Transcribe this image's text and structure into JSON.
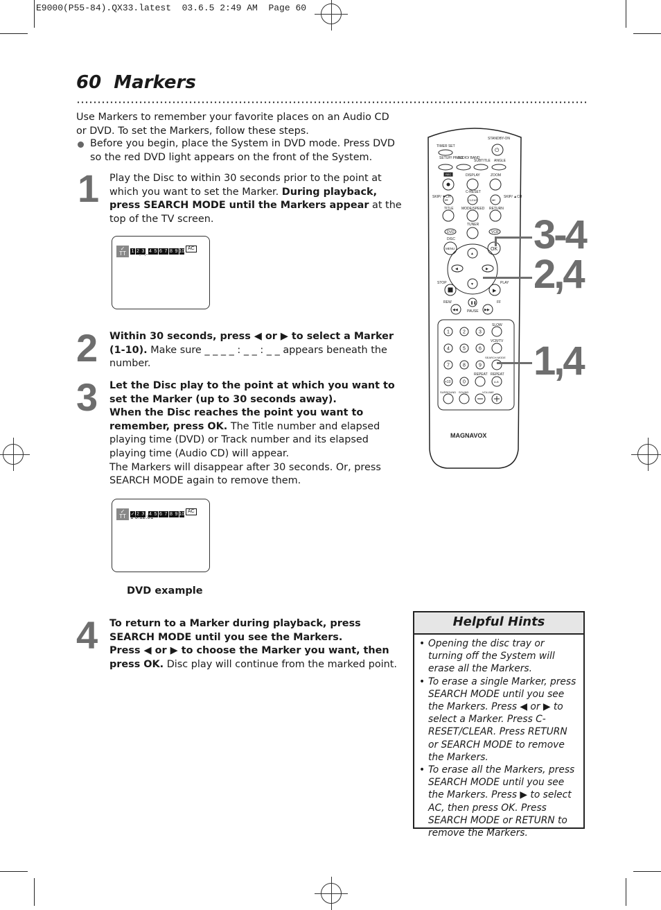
{
  "print_slug": "E9000(P55-84).QX33.latest  03.6.5 2:49 AM  Page 60",
  "header": {
    "page_number": "60",
    "title": "Markers"
  },
  "intro": {
    "text": "Use Markers to remember your favorite places on an Audio CD or DVD. To set the Markers, follow these steps.",
    "bullet": "Before you begin, place the System in DVD mode. Press DVD so the red DVD light appears on the front of the System."
  },
  "steps": [
    {
      "number": "1",
      "plain1": "Play the Disc to within 30 seconds prior to the point at which you want to set the Marker. ",
      "bold1": "During playback, press SEARCH MODE until the Markers appear",
      "plain2": " at the top of the TV screen."
    },
    {
      "number": "2",
      "bold1": "Within 30 seconds, press ◀ or ▶ to select a Marker (1-10).",
      "plain1": " Make sure _ _  _ _ : _ _ : _ _  appears beneath the number."
    },
    {
      "number": "3",
      "bold1": "Let the Disc play to the point at which you want to set the Marker (up to 30 seconds away).",
      "bold2": "When the Disc reaches the point you want to remember, press OK.",
      "plain1": " The Title number and elapsed playing time (DVD) or Track number and its elapsed playing time (Audio CD) will appear.",
      "plain2": "The Markers will disappear after 30 seconds. Or, press SEARCH MODE again to remove them."
    },
    {
      "number": "4",
      "bold1": "To return to a Marker during playback, press SEARCH MODE until you  see the Markers.",
      "bold2": "Press ◀ or ▶ to choose the Marker you want, then press OK.",
      "plain1": " Disc play will continue from the marked point."
    }
  ],
  "screens": [
    {
      "marker_icon": "✓",
      "title_icon": "TT",
      "markers": [
        "1",
        "2",
        "3",
        "4",
        "5",
        "6",
        "7",
        "8",
        "9",
        "10"
      ],
      "clear_all": "AC",
      "readout": "-- --:--:--"
    },
    {
      "marker_icon": "✓",
      "title_icon": "TT",
      "markers": [
        "✓",
        "2",
        "3",
        "4",
        "5",
        "6",
        "7",
        "8",
        "9",
        "10"
      ],
      "clear_all": "AC",
      "readout": "1  0:12:01"
    }
  ],
  "screen_caption": "DVD example",
  "hints": {
    "title": "Helpful Hints",
    "items": [
      "Opening the disc tray or turning off the System will erase all the Markers.",
      "To erase a single Marker, press SEARCH MODE until you see the Markers. Press ◀ or ▶ to select a Marker. Press C-RESET/CLEAR. Press RETURN or SEARCH MODE to remove the Markers.",
      "To erase all the Markers, press SEARCH MODE until you see the Markers. Press ▶ to select AC, then press OK. Press SEARCH MODE or RETURN to remove the Markers."
    ]
  },
  "callouts": [
    "3-4",
    "2,4",
    "1,4"
  ],
  "remote": {
    "brand": "MAGNAVOX",
    "labels": {
      "standby": "STANDBY-ON",
      "timer_set": "TIMER SET",
      "setup": "SETUP/ PROG.",
      "audio": "AUDIO/ BAND",
      "subtitle": "SUBTITLE",
      "angle": "ANGLE",
      "rec": "REC",
      "display": "DISPLAY",
      "zoom": "ZOOM",
      "c_reset": "C-RESET",
      "clear": "CLEAR",
      "skip_down": "SKIP/ ▼CH",
      "skip_up": "SKIP/ ▲CH",
      "title": "TITLE",
      "mode_speed": "MODE/SPEED",
      "return": "RETURN",
      "tuner": "TUNER",
      "dvd": "DVD",
      "vcr": "VCR",
      "disc": "DISC",
      "menu": "MENU",
      "ok": "OK",
      "stop": "STOP",
      "play": "PLAY",
      "rew": "REW",
      "ff": "FF",
      "pause": "PAUSE",
      "slow": "SLOW",
      "vcr_tv": "VCR/TV",
      "search_mode": "SEARCH MODE",
      "repeat": "REPEAT",
      "repeat_ab": "REPEAT",
      "ab": "A-B",
      "plus10": "+10",
      "surround": "SURROUND",
      "sound": "SOUND",
      "volume": "VOLUME"
    },
    "digits": [
      "1",
      "2",
      "3",
      "4",
      "5",
      "6",
      "7",
      "8",
      "9",
      "0"
    ]
  }
}
